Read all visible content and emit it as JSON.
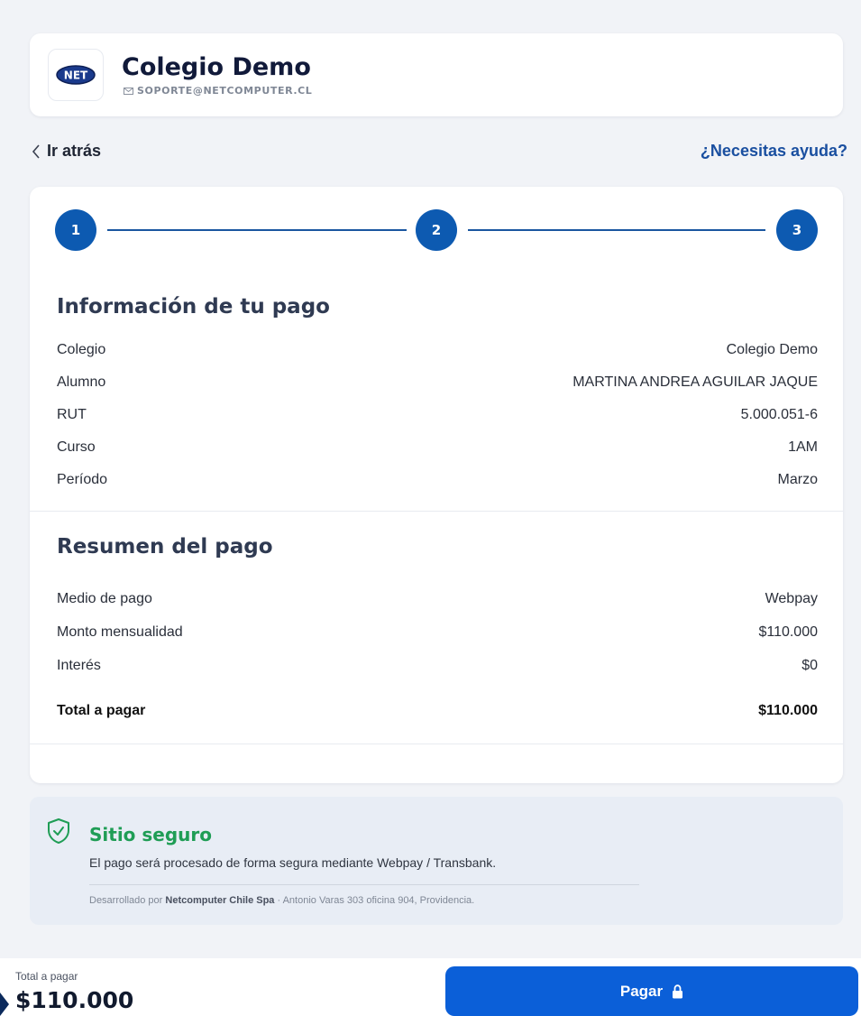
{
  "header": {
    "logo_text": "NET",
    "school_name": "Colegio Demo",
    "email": "SOPORTE@NETCOMPUTER.CL"
  },
  "nav": {
    "back_label": "Ir atrás",
    "help_label": "¿Necesitas ayuda?"
  },
  "stepper": {
    "steps": [
      "1",
      "2",
      "3"
    ],
    "current": 3
  },
  "payment_info": {
    "title": "Información de tu pago",
    "rows": [
      {
        "label": "Colegio",
        "value": "Colegio Demo"
      },
      {
        "label": "Alumno",
        "value": "MARTINA ANDREA AGUILAR JAQUE"
      },
      {
        "label": "RUT",
        "value": "5.000.051-6"
      },
      {
        "label": "Curso",
        "value": "1AM"
      },
      {
        "label": "Período",
        "value": "Marzo"
      }
    ]
  },
  "summary": {
    "title": "Resumen del pago",
    "rows": [
      {
        "label": "Medio de pago",
        "value": "Webpay"
      },
      {
        "label": "Monto mensualidad",
        "value": "$110.000"
      },
      {
        "label": "Interés",
        "value": "$0"
      }
    ],
    "total_label": "Total a pagar",
    "total_value": "$110.000"
  },
  "secure": {
    "title": "Sitio seguro",
    "text": "El pago será procesado de forma segura mediante Webpay / Transbank.",
    "footer_prefix": "Desarrollado por",
    "footer_company": "Netcomputer Chile Spa",
    "footer_address": "· Antonio Varas 303 oficina 904, Providencia."
  },
  "bottom": {
    "total_label": "Total a pagar",
    "total_amount": "$110.000",
    "pay_label": "Pagar"
  },
  "colors": {
    "primary": "#0b5fd8",
    "step": "#0d5ab1",
    "secure_green": "#1f9d55",
    "help_link": "#1a4fa0"
  }
}
